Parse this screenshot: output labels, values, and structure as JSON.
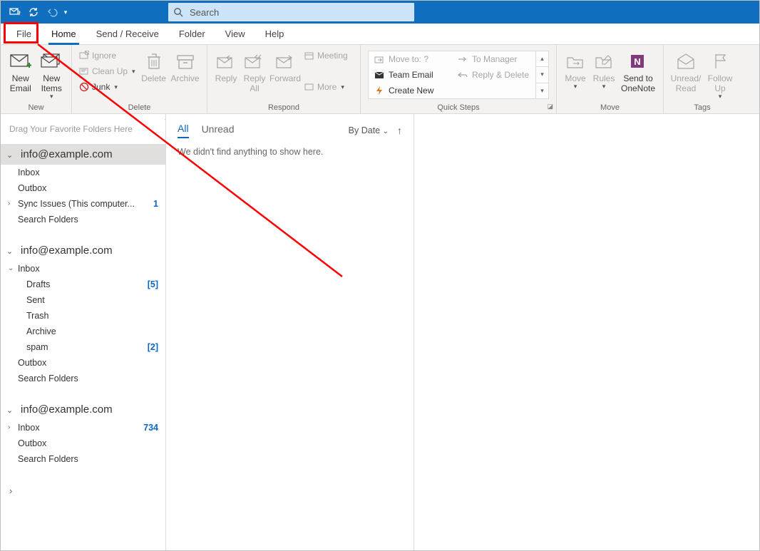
{
  "search": {
    "placeholder": "Search"
  },
  "tabs": {
    "file": "File",
    "home": "Home",
    "sendrec": "Send / Receive",
    "folder": "Folder",
    "view": "View",
    "help": "Help"
  },
  "ribbon": {
    "new": {
      "label": "New",
      "new_email": "New\nEmail",
      "new_items": "New\nItems"
    },
    "mid": {
      "ignore": "Ignore",
      "cleanup": "Clean Up",
      "junk": "Junk"
    },
    "delete": {
      "label": "Delete",
      "delete": "Delete",
      "archive": "Archive"
    },
    "respond": {
      "label": "Respond",
      "reply": "Reply",
      "replyall": "Reply\nAll",
      "forward": "Forward",
      "meeting": "Meeting",
      "more": "More"
    },
    "quicksteps": {
      "label": "Quick Steps",
      "moveto": "Move to: ?",
      "team": "Team Email",
      "create": "Create New",
      "mgr": "To Manager",
      "rd": "Reply & Delete"
    },
    "move": {
      "label": "Move",
      "move": "Move",
      "rules": "Rules",
      "onenote": "Send to\nOneNote"
    },
    "tags": {
      "label": "Tags",
      "unread": "Unread/\nRead",
      "followup": "Follow\nUp"
    }
  },
  "nav": {
    "favhint": "Drag Your Favorite Folders Here",
    "accounts": [
      {
        "email": "info@example.com",
        "expanded": true,
        "selected": true,
        "folders": [
          {
            "name": "Inbox"
          },
          {
            "name": "Outbox"
          },
          {
            "name": "Sync Issues (This computer...",
            "count": "1",
            "expandable": true
          },
          {
            "name": "Search Folders"
          }
        ]
      },
      {
        "email": "info@example.com",
        "expanded": true,
        "folders": [
          {
            "name": "Inbox",
            "expandable": true,
            "open": true,
            "children": [
              {
                "name": "Drafts",
                "count": "[5]"
              },
              {
                "name": "Sent"
              },
              {
                "name": "Trash"
              },
              {
                "name": "Archive"
              },
              {
                "name": "spam",
                "count": "[2]"
              }
            ]
          },
          {
            "name": "Outbox"
          },
          {
            "name": "Search Folders"
          }
        ]
      },
      {
        "email": "info@example.com",
        "expanded": true,
        "folders": [
          {
            "name": "Inbox",
            "count": "734",
            "expandable": true
          },
          {
            "name": "Outbox"
          },
          {
            "name": "Search Folders"
          }
        ]
      }
    ]
  },
  "list": {
    "all": "All",
    "unread": "Unread",
    "sort": "By Date",
    "empty": "We didn't find anything to show here."
  }
}
